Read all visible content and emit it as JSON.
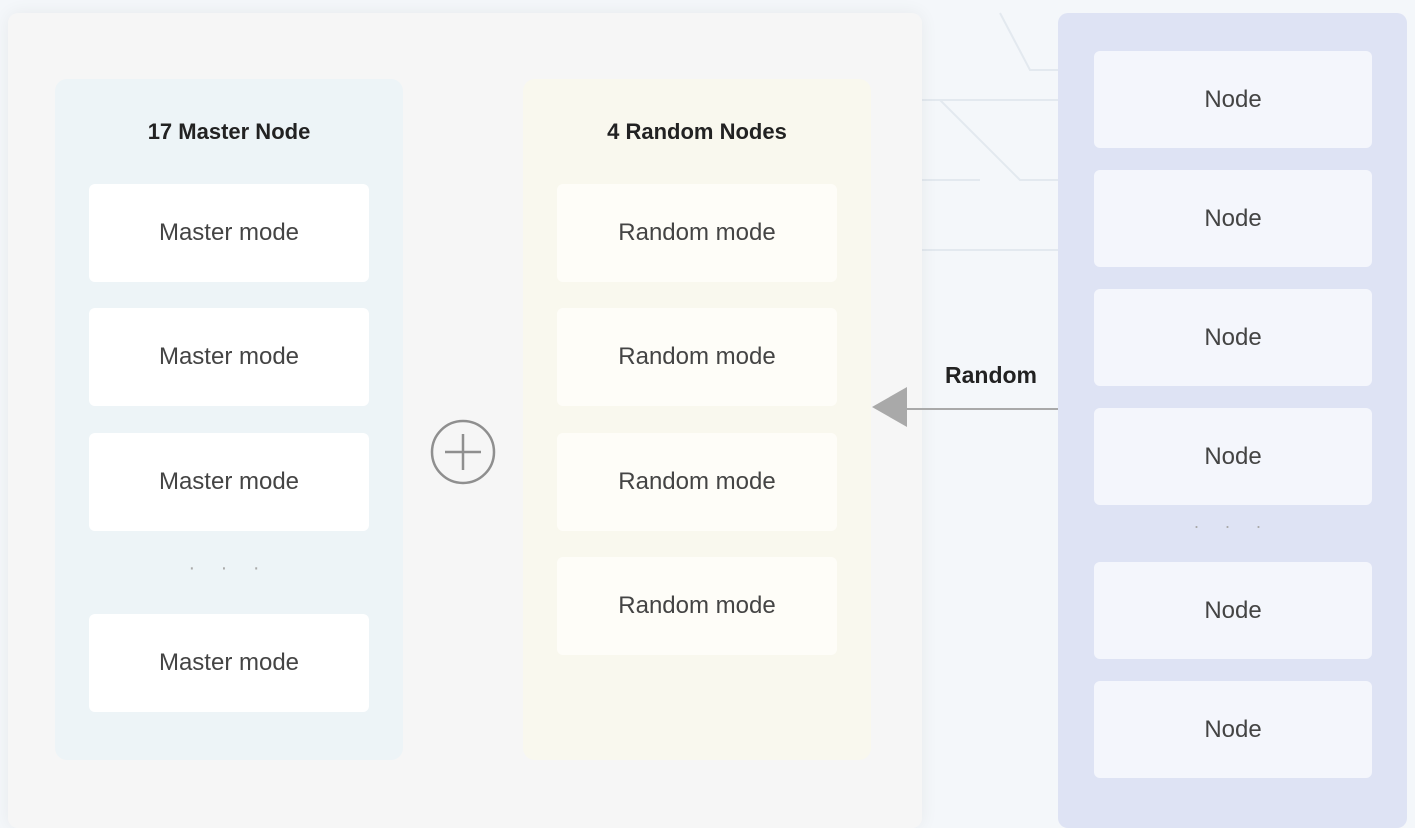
{
  "master_column": {
    "title": "17 Master Node",
    "items": [
      "Master mode",
      "Master mode",
      "Master mode",
      "Master mode"
    ],
    "ellipsis": "· · ·"
  },
  "random_column": {
    "title": "4 Random Nodes",
    "items": [
      "Random mode",
      "Random mode",
      "Random mode",
      "Random mode"
    ]
  },
  "pool_column": {
    "items": [
      "Node",
      "Node",
      "Node",
      "Node",
      "Node",
      "Node"
    ],
    "ellipsis": "· · ·"
  },
  "arrow": {
    "label": "Random"
  },
  "colors": {
    "master_bg": "#edf4f7",
    "random_bg": "#f9f8ee",
    "pool_bg": "#dee3f4",
    "arrow": "#a9a9a9"
  },
  "icons": {
    "plus": "plus-circle-icon",
    "arrow": "arrow-left-icon"
  }
}
